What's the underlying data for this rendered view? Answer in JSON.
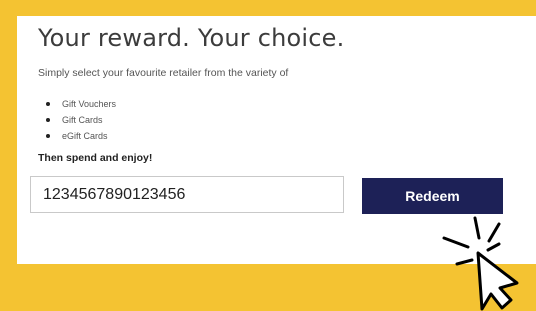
{
  "reward": {
    "title": "Your reward. Your choice.",
    "subtitle": "Simply select your favourite retailer from the variety of",
    "options": [
      "Gift Vouchers",
      "Gift Cards",
      "eGift Cards"
    ],
    "callout": "Then spend and enjoy!"
  },
  "form": {
    "code_value": "1234567890123456",
    "redeem_label": "Redeem"
  },
  "colors": {
    "background": "#f4c332",
    "card": "#ffffff",
    "button": "#1d2157",
    "button_text": "#ffffff"
  },
  "icons": {
    "pointer": "click-cursor-icon"
  }
}
